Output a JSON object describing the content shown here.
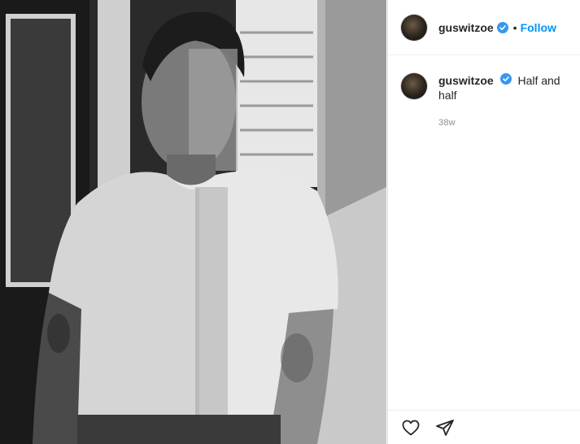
{
  "post": {
    "username": "guswitzoe",
    "follow_label": "Follow",
    "separator": "•",
    "caption_username": "guswitzoe",
    "caption_text": "Half and half",
    "timestamp": "38w"
  },
  "icons": {
    "verified": "verified-badge-icon",
    "like": "heart-icon",
    "share": "paper-plane-icon"
  },
  "colors": {
    "accent": "#0095f6",
    "text": "#262626",
    "muted": "#8e8e8e",
    "border": "#dbdbdb"
  }
}
